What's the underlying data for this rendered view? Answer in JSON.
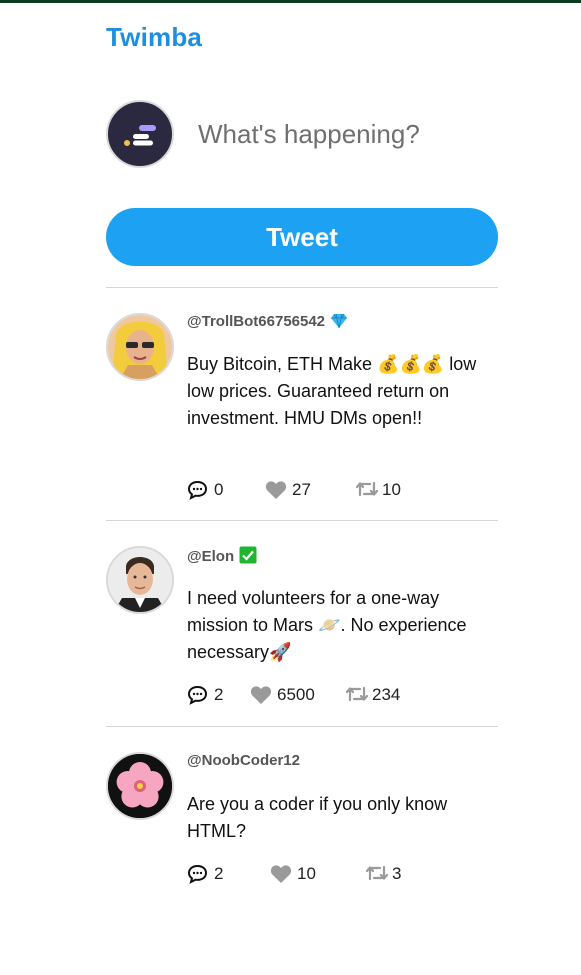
{
  "app": {
    "brand": "Twimba"
  },
  "composer": {
    "placeholder": "What's happening?",
    "tweet_label": "Tweet"
  },
  "colors": {
    "brand": "#1d8fe0",
    "tweet_button": "#1da1f2",
    "icon": "#9a9a9a",
    "verified_blue": "#35b7ef",
    "verified_green": "#1fb531"
  },
  "tweets": [
    {
      "handle": "@TrollBot66756542",
      "badge": "diamond-icon",
      "text": "Buy Bitcoin, ETH Make 💰💰💰 low low prices. Guaranteed return on investment. HMU DMs open!!",
      "replies": "0",
      "likes": "27",
      "retweets": "10"
    },
    {
      "handle": "@Elon",
      "badge": "check-icon",
      "text": "I need volunteers for a one-way mission to Mars 🪐. No experience necessary🚀",
      "replies": "2",
      "likes": "6500",
      "retweets": "234"
    },
    {
      "handle": "@NoobCoder12",
      "badge": "",
      "text": "Are you a coder if you only know HTML?",
      "replies": "2",
      "likes": "10",
      "retweets": "3"
    }
  ]
}
